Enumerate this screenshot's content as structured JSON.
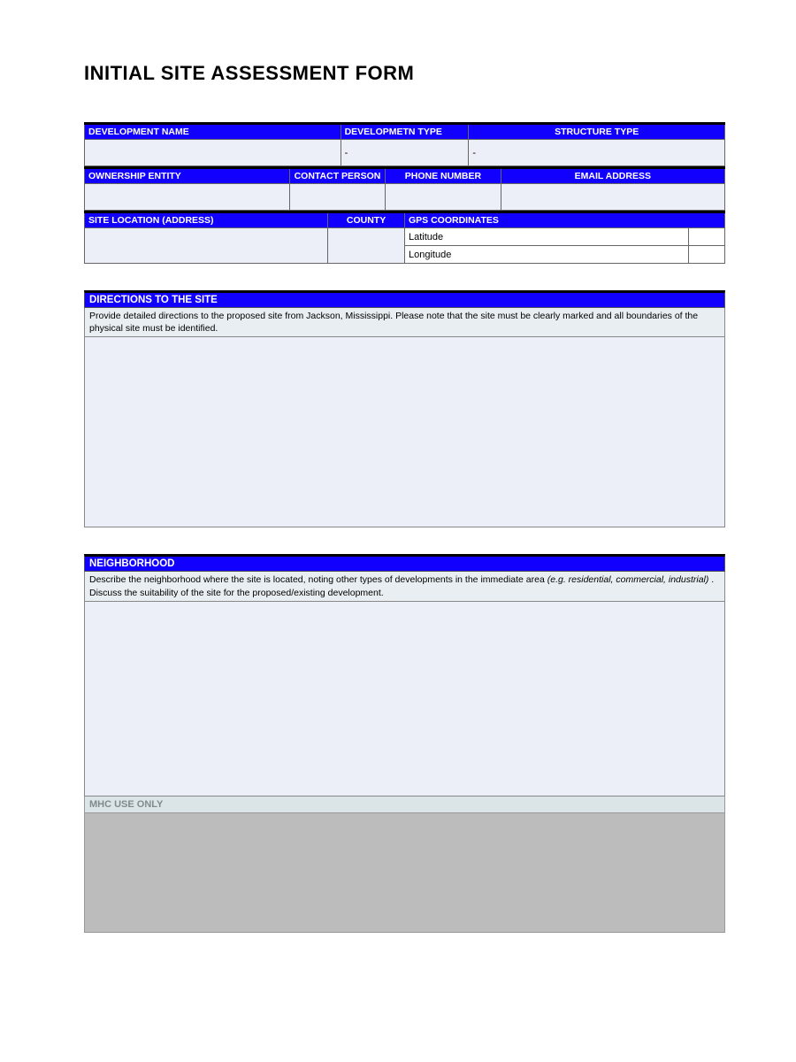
{
  "title": "INITIAL SITE ASSESSMENT FORM",
  "row1": {
    "dev_name_label": "DEVELOPMENT NAME",
    "dev_type_label": "DEVELOPMETN TYPE",
    "structure_type_label": "STRUCTURE TYPE",
    "dev_name": "",
    "dev_type": "-",
    "structure_type": "-"
  },
  "row2": {
    "ownership_label": "OWNERSHIP ENTITY",
    "contact_label": "CONTACT PERSON",
    "phone_label": "PHONE NUMBER",
    "email_label": "EMAIL ADDRESS",
    "ownership": "",
    "contact": "",
    "phone": "",
    "email": ""
  },
  "row3": {
    "site_location_label": "SITE LOCATION (ADDRESS)",
    "county_label": "COUNTY",
    "gps_label": "GPS COORDINATES",
    "lat_label": "Latitude",
    "lon_label": "Longitude",
    "site_location": "",
    "county": "",
    "lat": "",
    "lon": ""
  },
  "directions": {
    "header": "DIRECTIONS TO THE SITE",
    "instructions": "Provide detailed directions to the proposed site from Jackson, Mississippi.  Please note that the site must be clearly marked and all boundaries of the physical site must be identified.",
    "value": ""
  },
  "neighborhood": {
    "header": "NEIGHBORHOOD",
    "instr_pre": "Describe the neighborhood where the site is located, noting other types of developments in the immediate area ",
    "instr_em": "(e.g. residential, commercial, industrial)",
    "instr_post": " .  Discuss the suitability of the site for the proposed/existing development.",
    "value": ""
  },
  "mhc": {
    "header": "MHC USE ONLY",
    "value": ""
  }
}
